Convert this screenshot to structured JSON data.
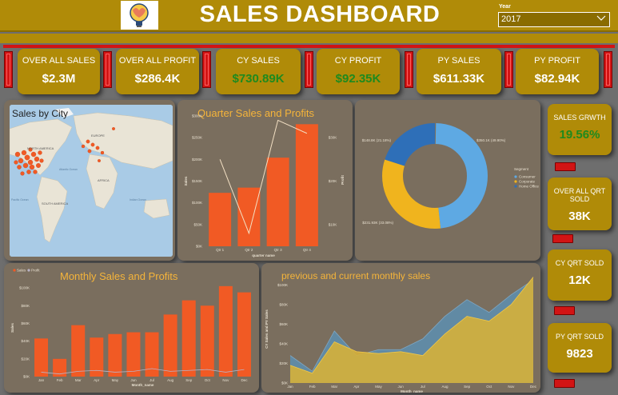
{
  "header": {
    "title": "SALES DASHBOARD",
    "logo_icon": "idea-brain-icon"
  },
  "slicer": {
    "label": "Year",
    "value": "2017"
  },
  "kpis": [
    {
      "label": "OVER ALL SALES",
      "value": "$2.3M",
      "value_color": "#ffffff"
    },
    {
      "label": "OVER ALL PROFIT",
      "value": "$286.4K",
      "value_color": "#ffffff"
    },
    {
      "label": "CY SALES",
      "value": "$730.89K",
      "value_color": "#1e8a1e"
    },
    {
      "label": "CY PROFIT",
      "value": "$92.35K",
      "value_color": "#1e8a1e"
    },
    {
      "label": "PY SALES",
      "value": "$611.33K",
      "value_color": "#ffffff"
    },
    {
      "label": "PY PROFIT",
      "value": "$82.94K",
      "value_color": "#ffffff"
    }
  ],
  "side_kpis": [
    {
      "label": "SALES GRWTH",
      "value": "19.56%",
      "value_color": "#1e8a1e"
    },
    {
      "label": "OVER ALL QRT SOLD",
      "value": "38K",
      "value_color": "#ffffff"
    },
    {
      "label": "CY QRT SOLD",
      "value": "12K",
      "value_color": "#ffffff"
    },
    {
      "label": "PY QRT SOLD",
      "value": "9823",
      "value_color": "#ffffff"
    }
  ],
  "map": {
    "title": "Sales by City",
    "labels": [
      "NORTH AMERICA",
      "EUROPE",
      "SOUTH AMERICA",
      "AFRICA",
      "Atlantic Ocean",
      "Pacific Ocean",
      "Indian Ocean"
    ]
  },
  "colors": {
    "accent": "#b08b08",
    "bar": "#f15a24",
    "line": "#f3e0c4",
    "donut_consumer": "#5ea9e3",
    "donut_corporate": "#f0b41e",
    "donut_home": "#2e6fb8",
    "area_py": "#5d8fb0",
    "area_cy": "#d6b03a"
  },
  "chart_data": [
    {
      "type": "bar",
      "title": "Quarter Sales and Profits",
      "categories": [
        "Qtr 1",
        "Qtr 2",
        "Qtr 3",
        "Qtr 4"
      ],
      "series": [
        {
          "name": "Sales",
          "values": [
            123000,
            135000,
            204000,
            281000
          ]
        },
        {
          "name": "Profit",
          "values": [
            25000,
            8000,
            34000,
            31000
          ]
        }
      ],
      "xlabel": "quarter name",
      "ylabel": "Sales",
      "y2label": "Profit",
      "y_ticks": [
        "$0K",
        "$50K",
        "$100K",
        "$150K",
        "$200K",
        "$250K",
        "$300K"
      ],
      "y2_ticks": [
        "$10K",
        "$20K",
        "$30K"
      ],
      "ylim": [
        0,
        300000
      ],
      "y2lim": [
        5000,
        35000
      ]
    },
    {
      "type": "pie",
      "title": "",
      "legend_title": "Segment",
      "categories": [
        "Consumer",
        "Corporate",
        "Home Office"
      ],
      "values": [
        350.1,
        231.93,
        148.8
      ],
      "data_labels": [
        "$350.1K (49.90%)",
        "$231.93K (33.08%)",
        "$148.8K (21.18%)"
      ],
      "legend": "right"
    },
    {
      "type": "bar",
      "title": "Monthly Sales and Profits",
      "categories": [
        "Jan",
        "Feb",
        "Mar",
        "Apr",
        "May",
        "Jun",
        "Jul",
        "Aug",
        "Sep",
        "Oct",
        "Nov",
        "Dec"
      ],
      "series": [
        {
          "name": "Sales",
          "values": [
            43000,
            20000,
            58000,
            44000,
            48000,
            50000,
            50000,
            70000,
            86000,
            80000,
            102000,
            95000
          ]
        },
        {
          "name": "Profit",
          "values": [
            5000,
            3000,
            6000,
            7000,
            5000,
            6000,
            9000,
            6000,
            7000,
            8000,
            5000,
            8000
          ]
        }
      ],
      "xlabel": "Month_name",
      "ylabel": "Sales",
      "y_ticks": [
        "$0K",
        "$20K",
        "$40K",
        "$60K",
        "$80K",
        "$100K"
      ],
      "ylim": [
        0,
        110000
      ],
      "legend": "top-left"
    },
    {
      "type": "area",
      "title": "previous and current monthly sales",
      "categories": [
        "Jan",
        "Feb",
        "Mar",
        "Apr",
        "May",
        "Jun",
        "Jul",
        "Aug",
        "Sep",
        "Oct",
        "Nov",
        "Dec"
      ],
      "series": [
        {
          "name": "PY Sales",
          "values": [
            28000,
            12000,
            53000,
            28000,
            34000,
            34000,
            45000,
            68000,
            85000,
            72000,
            90000,
            105000
          ]
        },
        {
          "name": "CY Sales",
          "values": [
            18000,
            10000,
            42000,
            32000,
            30000,
            32000,
            28000,
            50000,
            68000,
            63000,
            80000,
            108000
          ]
        }
      ],
      "xlabel": "Month_name",
      "ylabel": "CY Sales and PY Sales",
      "y_ticks": [
        "$0K",
        "$20K",
        "$40K",
        "$60K",
        "$80K",
        "$100K"
      ],
      "ylim": [
        0,
        110000
      ]
    }
  ]
}
